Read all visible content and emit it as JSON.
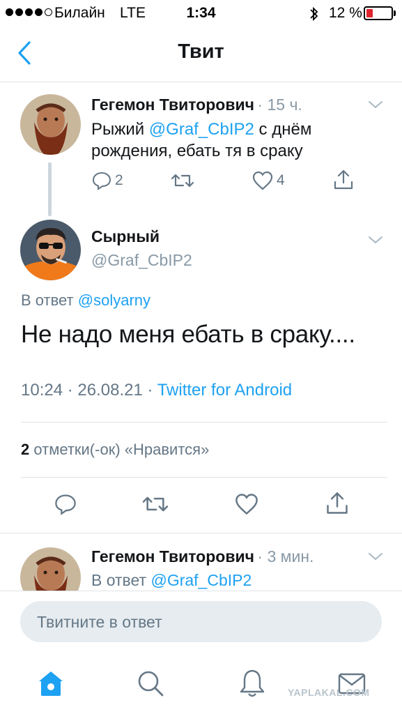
{
  "status_bar": {
    "carrier": "Билайн",
    "network": "LTE",
    "time": "1:34",
    "battery_text": "12 %",
    "battery_level": 0.12,
    "signal_bars_filled": 4,
    "signal_bars_total": 5,
    "icons": [
      "signal-dots-icon",
      "bluetooth-icon",
      "battery-icon"
    ]
  },
  "nav": {
    "title": "Твит",
    "back_icon": "chevron-left-icon"
  },
  "parent_tweet": {
    "author": "Гегемон Твиторович",
    "time": "· 15 ч.",
    "text_before": "Рыжий ",
    "mention": "@Graf_CbIP2",
    "text_after": " с днём рождения, ебать тя в сраку",
    "replies": "2",
    "retweets": "",
    "likes": "4"
  },
  "main_tweet": {
    "author": "Сырный",
    "handle": "@Graf_CbIP2",
    "reply_prefix": "В ответ ",
    "reply_to": "@solyarny",
    "text": "Не надо меня ебать в сраку....",
    "time": "10:24 · 26.08.21 · ",
    "source": "Twitter for Android",
    "likes_count": "2",
    "likes_label": " отметки(-ок) «Нравится»"
  },
  "reply_tweet": {
    "author": "Гегемон Твиторович",
    "time": "· 3 мин.",
    "reply_prefix": "В ответ ",
    "reply_to": "@Graf_CbIP2"
  },
  "composer": {
    "placeholder": "Твитните в ответ"
  },
  "tab_bar": {
    "items": [
      "home-icon",
      "search-icon",
      "notifications-icon",
      "messages-icon"
    ]
  },
  "watermark": "YAPLAKAL.COM",
  "colors": {
    "accent": "#1da1f2",
    "text": "#14171a",
    "secondary": "#657786",
    "divider": "#dfe3e6",
    "battery_low": "#e0242c"
  }
}
